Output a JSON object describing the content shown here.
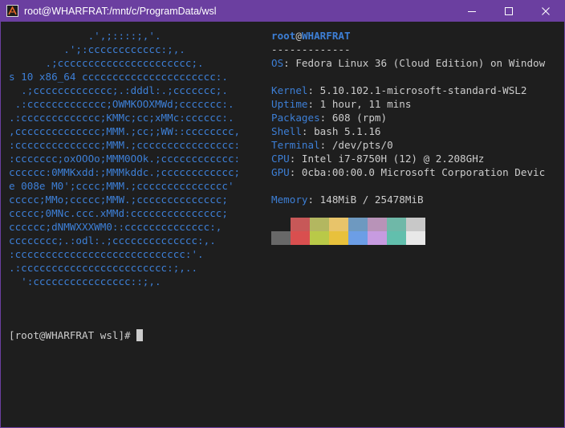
{
  "window": {
    "title": "root@WHARFRAT:/mnt/c/ProgramData/wsl",
    "accent": "#6b3fa0"
  },
  "logo": {
    "color": "#3d7fd6",
    "lines": [
      "             .',;::::;,'.",
      "         .';:cccccccccccc:;,.",
      "      .;cccccccccccccccccccccc;.",
      "s 10 x86_64 cccccccccccccccccccccc:.",
      "  .;ccccccccccccc;.:dddl:.;ccccccc;.",
      " .:ccccccccccccc;OWMKOOXMWd;ccccccc:.",
      ".:ccccccccccccc;KMMc;cc;xMMc:cccccc:.",
      ",cccccccccccccc;MMM.;cc;;WW::cccccccc,",
      ":cccccccccccccc;MMM.;cccccccccccccccc:",
      ":ccccccc;oxOOOo;MMM0OOk.;cccccccccccc:",
      "cccccc:0MMKxdd:;MMMkddc.;cccccccccccc;",
      "e 008e M0';cccc;MMM.;ccccccccccccccc'",
      "ccccc;MMo;ccccc;MMW.;cccccccccccccc;",
      "ccccc;0MNc.ccc.xMMd:ccccccccccccccc;",
      "cccccc;dNMWXXXWM0::cccccccccccccc:,",
      "cccccccc;.:odl:.;cccccccccccccc:,.",
      ":cccccccccccccccccccccccccccc:'.",
      ".:cccccccccccccccccccccccc:;,..",
      "  ':cccccccccccccccc::;,."
    ]
  },
  "info": {
    "user": "root",
    "at": "@",
    "host": "WHARFRAT",
    "separator": "-------------",
    "rows": [
      {
        "key": "OS",
        "value": "Fedora Linux 36 (Cloud Edition) on Window"
      },
      {
        "key": "Kernel",
        "value": "5.10.102.1-microsoft-standard-WSL2"
      },
      {
        "key": "Uptime",
        "value": "1 hour, 11 mins"
      },
      {
        "key": "Packages",
        "value": "608 (rpm)"
      },
      {
        "key": "Shell",
        "value": "bash 5.1.16"
      },
      {
        "key": "Terminal",
        "value": "/dev/pts/0"
      },
      {
        "key": "CPU",
        "value": "Intel i7-8750H (12) @ 2.208GHz"
      },
      {
        "key": "GPU",
        "value": "0cba:00:00.0 Microsoft Corporation Devic"
      },
      {
        "key": "Memory",
        "value": "148MiB / 25478MiB"
      }
    ],
    "colon": ": "
  },
  "palette": {
    "normal": [
      "#1e1e1e",
      "#c75858",
      "#b3b760",
      "#e8c46a",
      "#6e99c0",
      "#b893b8",
      "#6fb8a8",
      "#c8c8c8"
    ],
    "bright": [
      "#686868",
      "#d94f4f",
      "#b9c948",
      "#e8c13c",
      "#6c9ee6",
      "#c79be0",
      "#62bfad",
      "#e8e8e8"
    ]
  },
  "prompt": {
    "text": "[root@WHARFRAT wsl]# "
  }
}
